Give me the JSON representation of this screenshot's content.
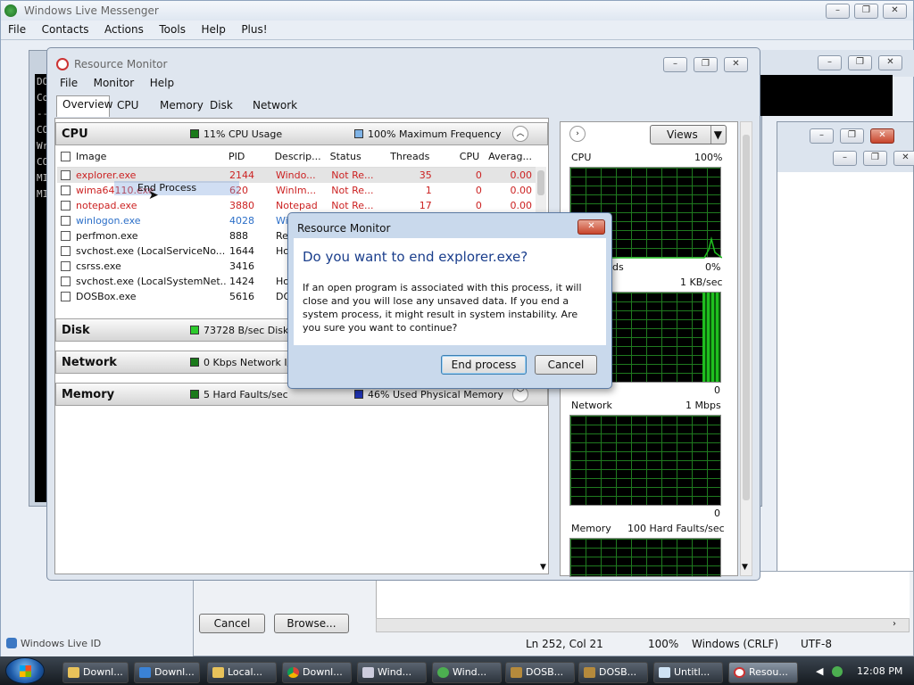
{
  "messenger": {
    "title": "Windows Live Messenger",
    "menu": [
      "File",
      "Contacts",
      "Actions",
      "Tools",
      "Help",
      "Plus!"
    ],
    "live_id": "Windows Live ID"
  },
  "console": {
    "lines": [
      "DO",
      "Co",
      "--",
      "CO",
      "Wr",
      "CO",
      "MI",
      "MI"
    ]
  },
  "notepad": {
    "cancel_label": "Cancel",
    "browse_label": "Browse...",
    "status_pos": "Ln 252, Col 21",
    "status_zoom": "100%",
    "status_eol": "Windows (CRLF)",
    "status_enc": "UTF-8"
  },
  "resmon": {
    "title": "Resource Monitor",
    "menu": [
      "File",
      "Monitor",
      "Help"
    ],
    "tabs": [
      "Overview",
      "CPU",
      "Memory",
      "Disk",
      "Network"
    ],
    "cpu": {
      "label": "CPU",
      "usage": "11% CPU Usage",
      "freq": "100% Maximum Frequency"
    },
    "columns": [
      "Image",
      "PID",
      "Descrip...",
      "Status",
      "Threads",
      "CPU",
      "Averag..."
    ],
    "processes": [
      {
        "image": "explorer.exe",
        "pid": "2144",
        "desc": "Windo...",
        "status": "Not Re...",
        "threads": "35",
        "cpu": "0",
        "avg": "0.00",
        "style": "red"
      },
      {
        "image": "wima64110.exe",
        "pid": "620",
        "desc": "WinIm...",
        "status": "Not Re...",
        "threads": "1",
        "cpu": "0",
        "avg": "0.00",
        "style": "red"
      },
      {
        "image": "notepad.exe",
        "pid": "3880",
        "desc": "Notepad",
        "status": "Not Re...",
        "threads": "17",
        "cpu": "0",
        "avg": "0.00",
        "style": "red"
      },
      {
        "image": "winlogon.exe",
        "pid": "4028",
        "desc": "Wind",
        "status": "",
        "threads": "",
        "cpu": "",
        "avg": "",
        "style": "blue"
      },
      {
        "image": "perfmon.exe",
        "pid": "888",
        "desc": "Reso",
        "status": "",
        "threads": "",
        "cpu": "",
        "avg": "",
        "style": ""
      },
      {
        "image": "svchost.exe (LocalServiceNo...",
        "pid": "1644",
        "desc": "Host",
        "status": "",
        "threads": "",
        "cpu": "",
        "avg": "",
        "style": ""
      },
      {
        "image": "csrss.exe",
        "pid": "3416",
        "desc": "",
        "status": "",
        "threads": "",
        "cpu": "",
        "avg": "",
        "style": ""
      },
      {
        "image": "svchost.exe (LocalSystemNet...",
        "pid": "1424",
        "desc": "Host",
        "status": "",
        "threads": "",
        "cpu": "",
        "avg": "",
        "style": ""
      },
      {
        "image": "DOSBox.exe",
        "pid": "5616",
        "desc": "DOS",
        "status": "",
        "threads": "",
        "cpu": "",
        "avg": "",
        "style": ""
      }
    ],
    "drag_label": "End Process",
    "disk": {
      "label": "Disk",
      "usage": "73728 B/sec Disk I"
    },
    "network": {
      "label": "Network",
      "usage": "0 Kbps Network I/"
    },
    "memory": {
      "label": "Memory",
      "faults": "5 Hard Faults/sec",
      "used": "46% Used Physical Memory"
    },
    "views_label": "Views",
    "graphs": {
      "cpu": {
        "label": "CPU",
        "max": "100%",
        "min": "0%",
        "partial": "ds"
      },
      "disk": {
        "max": "1 KB/sec",
        "min": "0"
      },
      "network": {
        "label": "Network",
        "max": "1 Mbps",
        "min": "0"
      },
      "memory": {
        "label": "Memory",
        "max": "100 Hard Faults/sec"
      }
    }
  },
  "dialog": {
    "title": "Resource Monitor",
    "heading": "Do you want to end explorer.exe?",
    "body": "If an open program is associated with this process, it will close and you will lose any unsaved data. If you end a system process, it might result in system instability. Are you sure you want to continue?",
    "ok_label": "End process",
    "cancel_label": "Cancel"
  },
  "taskbar": {
    "items": [
      "Downl...",
      "Downl...",
      "Local...",
      "Downl...",
      "Wind...",
      "Wind...",
      "DOSB...",
      "DOSB...",
      "Untitl...",
      "Resou..."
    ],
    "clock": "12:08 PM"
  },
  "colors": {
    "graph_green": "#1fbf1f",
    "taskbar": "#1c2228",
    "accent": "#3a7bd5"
  }
}
